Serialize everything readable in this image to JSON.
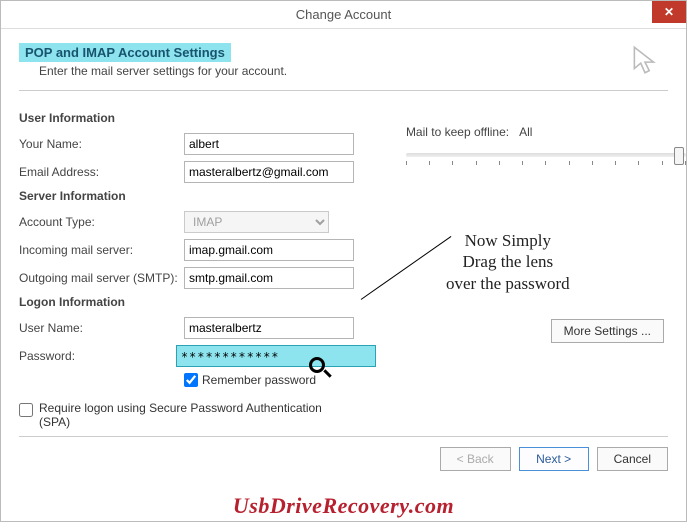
{
  "title": "Change Account",
  "header": {
    "title": "POP and IMAP Account Settings",
    "subtitle": "Enter the mail server settings for your account."
  },
  "sections": {
    "user_info": "User Information",
    "server_info": "Server Information",
    "logon_info": "Logon Information"
  },
  "labels": {
    "your_name": "Your Name:",
    "email": "Email Address:",
    "account_type": "Account Type:",
    "incoming": "Incoming mail server:",
    "outgoing": "Outgoing mail server (SMTP):",
    "user_name": "User Name:",
    "password": "Password:",
    "remember": "Remember password",
    "spa": "Require logon using Secure Password Authentication (SPA)",
    "mail_keep": "Mail to keep offline:",
    "mail_keep_val": "All"
  },
  "values": {
    "your_name": "albert",
    "email": "masteralbertz@gmail.com",
    "account_type": "IMAP",
    "incoming": "imap.gmail.com",
    "outgoing": "smtp.gmail.com",
    "user_name": "masteralbertz",
    "password": "************"
  },
  "annotation": "Now Simply\nDrag the lens\nover the password",
  "buttons": {
    "more": "More Settings ...",
    "back": "< Back",
    "next": "Next >",
    "cancel": "Cancel",
    "close": "✕"
  },
  "watermark": "UsbDriveRecovery.com"
}
